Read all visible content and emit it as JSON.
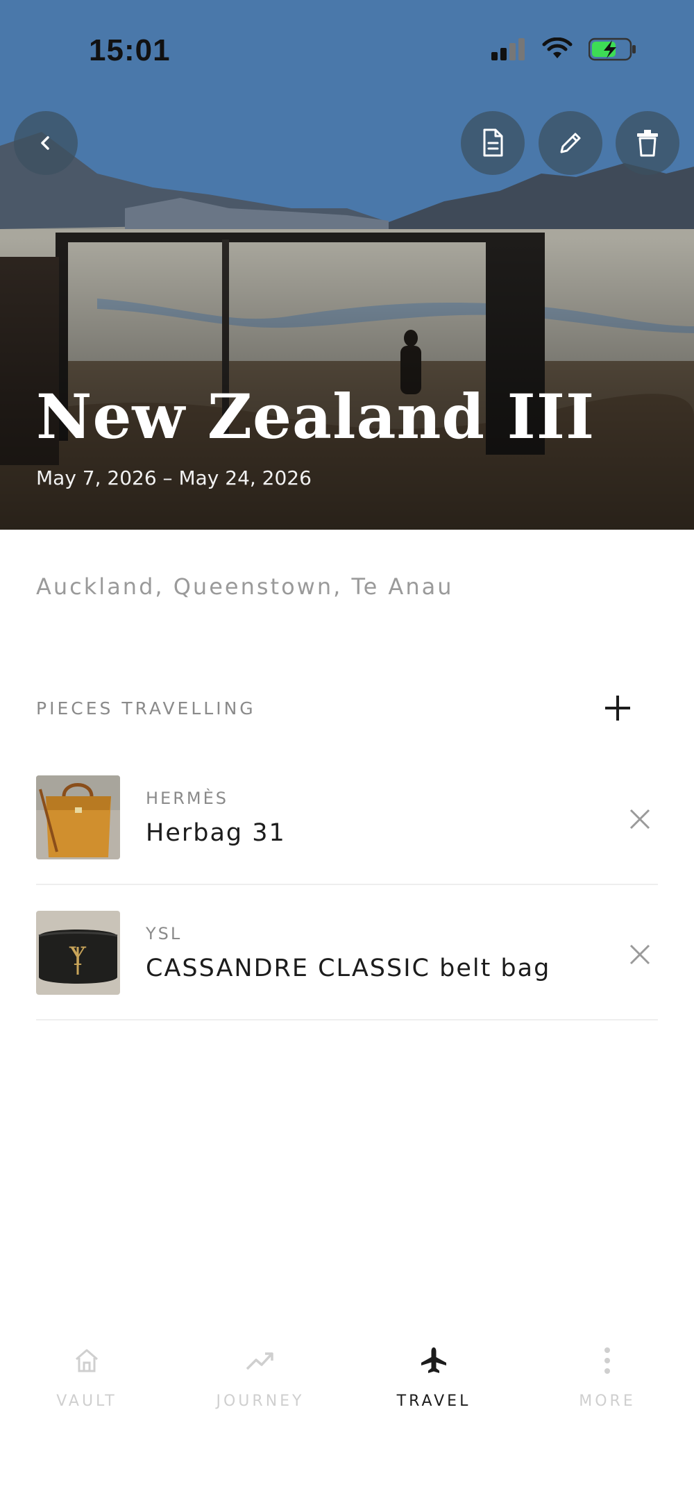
{
  "status_bar": {
    "time": "15:01"
  },
  "header": {
    "title": "New Zealand III",
    "dates": "May 7, 2026 – May 24, 2026",
    "actions": {
      "back_icon": "chevron-left-icon",
      "document_icon": "document-icon",
      "edit_icon": "pencil-icon",
      "delete_icon": "trash-icon"
    }
  },
  "trip": {
    "cities": "Auckland, Queenstown, Te Anau"
  },
  "pieces_section": {
    "heading": "PIECES TRAVELLING",
    "items": [
      {
        "brand": "HERMÈS",
        "name": "Herbag 31",
        "thumb_color": "#c88a2c"
      },
      {
        "brand": "YSL",
        "name": "CASSANDRE CLASSIC belt bag",
        "thumb_color": "#2a2a2a"
      }
    ]
  },
  "tabbar": {
    "items": [
      {
        "label": "VAULT",
        "icon": "home-icon",
        "active": false
      },
      {
        "label": "JOURNEY",
        "icon": "trending-up-icon",
        "active": false
      },
      {
        "label": "TRAVEL",
        "icon": "airplane-icon",
        "active": true
      },
      {
        "label": "MORE",
        "icon": "more-vertical-icon",
        "active": false
      }
    ]
  }
}
